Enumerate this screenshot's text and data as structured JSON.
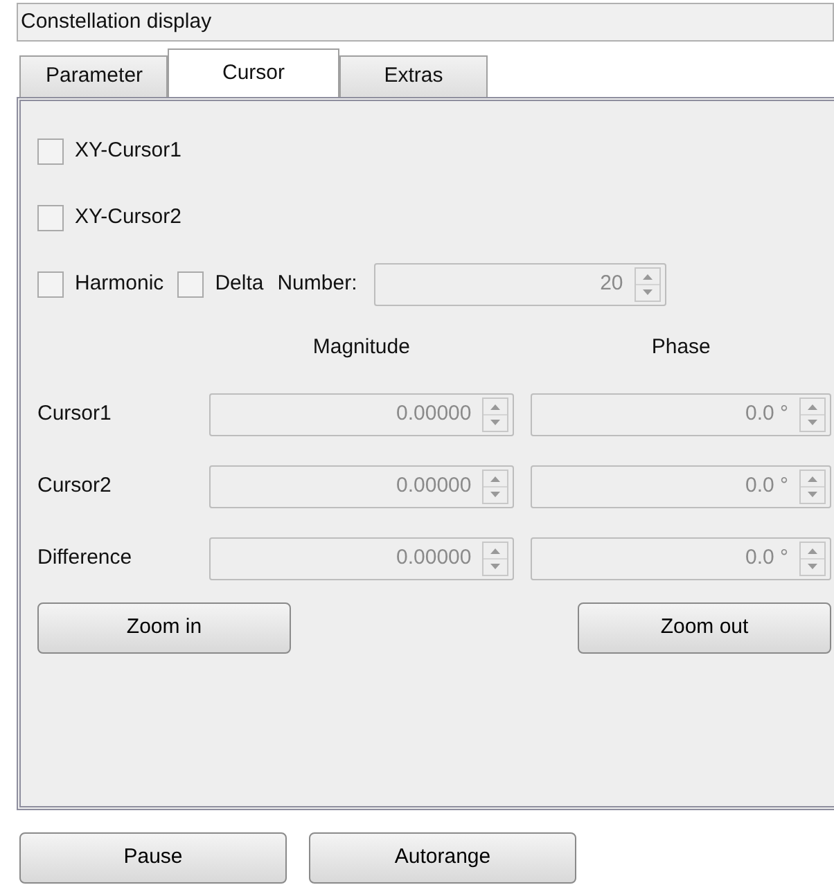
{
  "window": {
    "title": "Constellation display"
  },
  "tabs": [
    {
      "label": "Parameter",
      "selected": false
    },
    {
      "label": "Cursor",
      "selected": true
    },
    {
      "label": "Extras",
      "selected": false
    }
  ],
  "cursor_checkboxes": [
    {
      "label": "XY-Cursor1",
      "checked": false
    },
    {
      "label": "XY-Cursor2",
      "checked": false
    }
  ],
  "options": [
    {
      "label": "Harmonic",
      "checked": false
    },
    {
      "label": "Delta",
      "checked": false
    }
  ],
  "number": {
    "label": "Number:",
    "value": "20",
    "disabled": true
  },
  "columns": [
    "Magnitude",
    "Phase"
  ],
  "rows": [
    {
      "label": "Cursor1",
      "magnitude": "0.00000",
      "phase": "0.0 °",
      "disabled": true
    },
    {
      "label": "Cursor2",
      "magnitude": "0.00000",
      "phase": "0.0 °",
      "disabled": true
    },
    {
      "label": "Difference",
      "magnitude": "0.00000",
      "phase": "0.0 °",
      "disabled": true
    }
  ],
  "zoom_buttons": [
    "Zoom in",
    "Zoom out"
  ],
  "bottom_buttons": [
    "Pause",
    "Autorange"
  ]
}
